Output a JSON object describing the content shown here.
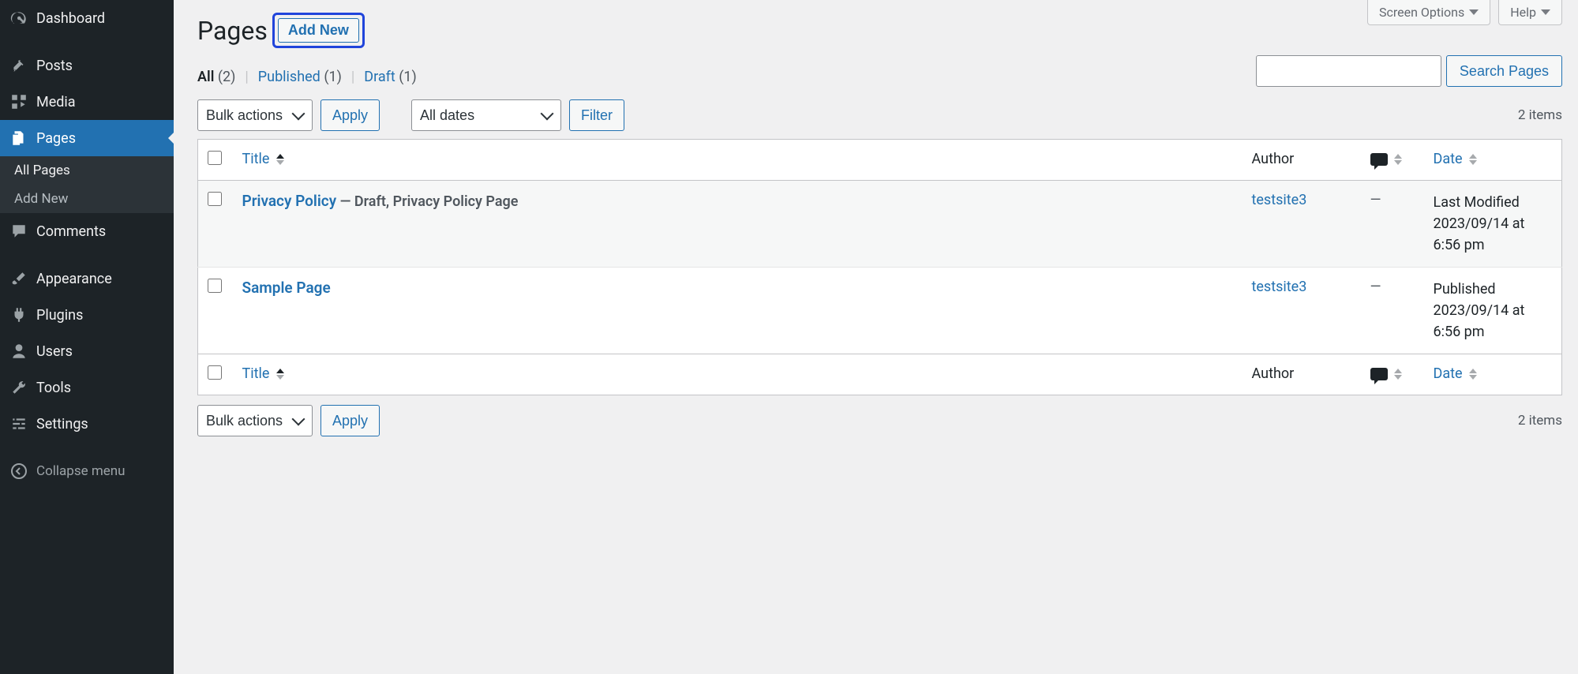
{
  "sidebar": {
    "items": [
      {
        "id": "dashboard",
        "label": "Dashboard",
        "icon": "dashboard"
      },
      {
        "id": "posts",
        "label": "Posts",
        "icon": "pin"
      },
      {
        "id": "media",
        "label": "Media",
        "icon": "media"
      },
      {
        "id": "pages",
        "label": "Pages",
        "icon": "pages",
        "active": true
      },
      {
        "id": "comments",
        "label": "Comments",
        "icon": "comment"
      },
      {
        "id": "appearance",
        "label": "Appearance",
        "icon": "brush"
      },
      {
        "id": "plugins",
        "label": "Plugins",
        "icon": "plug"
      },
      {
        "id": "users",
        "label": "Users",
        "icon": "user"
      },
      {
        "id": "tools",
        "label": "Tools",
        "icon": "wrench"
      },
      {
        "id": "settings",
        "label": "Settings",
        "icon": "sliders"
      }
    ],
    "submenu": {
      "all_pages": "All Pages",
      "add_new": "Add New"
    },
    "collapse": "Collapse menu"
  },
  "top_tabs": {
    "screen_options": "Screen Options",
    "help": "Help"
  },
  "heading": "Pages",
  "add_new_btn": "Add New",
  "filters": {
    "all": "All",
    "all_count": "(2)",
    "published": "Published",
    "published_count": "(1)",
    "draft": "Draft",
    "draft_count": "(1)"
  },
  "search": {
    "button": "Search Pages"
  },
  "bulk_actions": "Bulk actions",
  "all_dates": "All dates",
  "apply": "Apply",
  "filter": "Filter",
  "items_count": "2 items",
  "columns": {
    "title": "Title",
    "author": "Author",
    "date": "Date"
  },
  "rows": [
    {
      "title": "Privacy Policy",
      "state": " — Draft, Privacy Policy Page",
      "author": "testsite3",
      "comments": "—",
      "date_status": "Last Modified",
      "date_time": "2023/09/14 at 6:56 pm"
    },
    {
      "title": "Sample Page",
      "state": "",
      "author": "testsite3",
      "comments": "—",
      "date_status": "Published",
      "date_time": "2023/09/14 at 6:56 pm"
    }
  ]
}
